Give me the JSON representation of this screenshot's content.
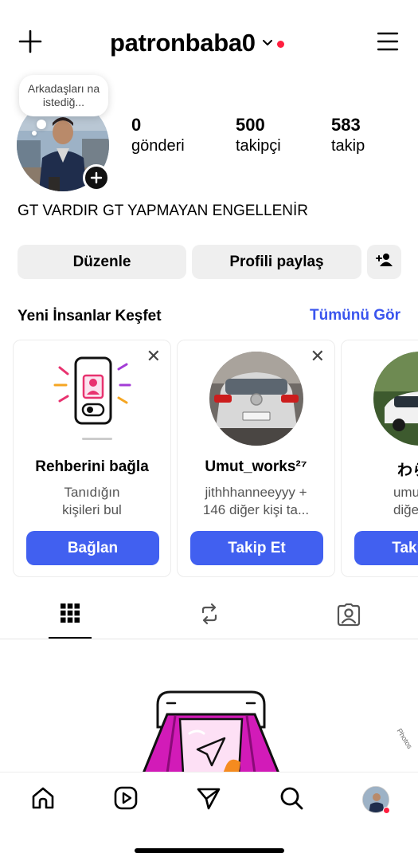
{
  "header": {
    "username": "patronbaba0",
    "create_icon": "plus-icon",
    "menu_icon": "hamburger-icon",
    "notification_color": "#ff1f3f"
  },
  "profile": {
    "note_text": "Arkadaşları na istediğ...",
    "stats": [
      {
        "value": "0",
        "label": "gönderi"
      },
      {
        "value": "500",
        "label": "takipçi"
      },
      {
        "value": "583",
        "label": "takip"
      }
    ],
    "bio": "GT VARDIR GT YAPMAYAN ENGELLENİR"
  },
  "actions": {
    "edit_label": "Düzenle",
    "share_label": "Profili paylaş",
    "discover_people_icon": "person-add-icon"
  },
  "discover": {
    "title": "Yeni İnsanlar Keşfet",
    "see_all": "Tümünü Gör",
    "accent_color": "#3a55ee",
    "cards": [
      {
        "title": "Rehberini bağla",
        "subtitle_line1": "Tanıdığın",
        "subtitle_line2": "kişileri bul",
        "button": "Bağlan"
      },
      {
        "title": "Umut_works²⁷",
        "subtitle_line1": "jithhhanneeyyy +",
        "subtitle_line2": "146 diğer kişi ta...",
        "button": "Takip Et"
      },
      {
        "title": "わらび",
        "subtitle_line1": "umut.pro",
        "subtitle_line2": "diğer kişi",
        "button": "Takip Et"
      }
    ]
  },
  "tabs": [
    {
      "name": "grid",
      "icon": "grid-icon",
      "active": true
    },
    {
      "name": "reposts",
      "icon": "repost-icon",
      "active": false
    },
    {
      "name": "tagged",
      "icon": "tagged-person-icon",
      "active": false
    }
  ],
  "side_text": "Photos",
  "bottom_nav": [
    {
      "name": "home",
      "icon": "home-icon"
    },
    {
      "name": "reels",
      "icon": "reels-icon"
    },
    {
      "name": "direct",
      "icon": "send-icon"
    },
    {
      "name": "search",
      "icon": "search-icon"
    },
    {
      "name": "profile",
      "icon": "profile-avatar"
    }
  ]
}
